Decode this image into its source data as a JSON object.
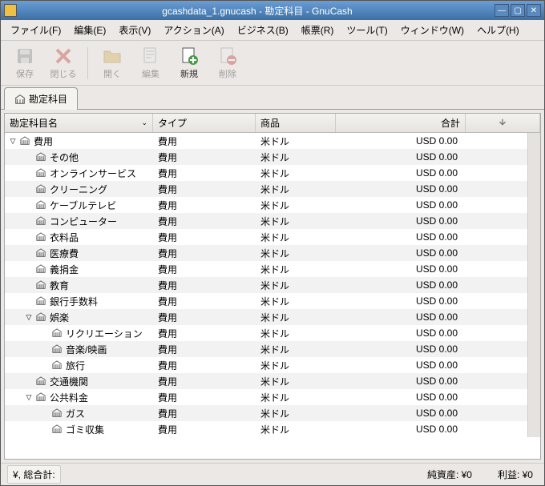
{
  "title": "gcashdata_1.gnucash - 勘定科目 - GnuCash",
  "menu": {
    "file": "ファイル(F)",
    "edit": "編集(E)",
    "view": "表示(V)",
    "actions": "アクション(A)",
    "business": "ビジネス(B)",
    "reports": "帳票(R)",
    "tools": "ツール(T)",
    "windows": "ウィンドウ(W)",
    "help": "ヘルプ(H)"
  },
  "toolbar": {
    "save": "保存",
    "close": "閉じる",
    "open": "開く",
    "edit": "編集",
    "new": "新規",
    "delete": "削除"
  },
  "tab": {
    "label": "勘定科目"
  },
  "headers": {
    "name": "勘定科目名",
    "type": "タイプ",
    "commodity": "商品",
    "total": "合計"
  },
  "rows": [
    {
      "indent": 0,
      "expander": "▽",
      "name": "費用",
      "type": "費用",
      "commodity": "米ドル",
      "total": "USD 0.00"
    },
    {
      "indent": 1,
      "expander": "",
      "name": "その他",
      "type": "費用",
      "commodity": "米ドル",
      "total": "USD 0.00"
    },
    {
      "indent": 1,
      "expander": "",
      "name": "オンラインサービス",
      "type": "費用",
      "commodity": "米ドル",
      "total": "USD 0.00"
    },
    {
      "indent": 1,
      "expander": "",
      "name": "クリーニング",
      "type": "費用",
      "commodity": "米ドル",
      "total": "USD 0.00"
    },
    {
      "indent": 1,
      "expander": "",
      "name": "ケーブルテレビ",
      "type": "費用",
      "commodity": "米ドル",
      "total": "USD 0.00"
    },
    {
      "indent": 1,
      "expander": "",
      "name": "コンピューター",
      "type": "費用",
      "commodity": "米ドル",
      "total": "USD 0.00"
    },
    {
      "indent": 1,
      "expander": "",
      "name": "衣料品",
      "type": "費用",
      "commodity": "米ドル",
      "total": "USD 0.00"
    },
    {
      "indent": 1,
      "expander": "",
      "name": "医療費",
      "type": "費用",
      "commodity": "米ドル",
      "total": "USD 0.00"
    },
    {
      "indent": 1,
      "expander": "",
      "name": "義捐金",
      "type": "費用",
      "commodity": "米ドル",
      "total": "USD 0.00"
    },
    {
      "indent": 1,
      "expander": "",
      "name": "教育",
      "type": "費用",
      "commodity": "米ドル",
      "total": "USD 0.00"
    },
    {
      "indent": 1,
      "expander": "",
      "name": "銀行手数料",
      "type": "費用",
      "commodity": "米ドル",
      "total": "USD 0.00"
    },
    {
      "indent": 1,
      "expander": "▽",
      "name": "娯楽",
      "type": "費用",
      "commodity": "米ドル",
      "total": "USD 0.00"
    },
    {
      "indent": 2,
      "expander": "",
      "name": "リクリエーション",
      "type": "費用",
      "commodity": "米ドル",
      "total": "USD 0.00"
    },
    {
      "indent": 2,
      "expander": "",
      "name": "音楽/映画",
      "type": "費用",
      "commodity": "米ドル",
      "total": "USD 0.00"
    },
    {
      "indent": 2,
      "expander": "",
      "name": "旅行",
      "type": "費用",
      "commodity": "米ドル",
      "total": "USD 0.00"
    },
    {
      "indent": 1,
      "expander": "",
      "name": "交通機関",
      "type": "費用",
      "commodity": "米ドル",
      "total": "USD 0.00"
    },
    {
      "indent": 1,
      "expander": "▽",
      "name": "公共料金",
      "type": "費用",
      "commodity": "米ドル",
      "total": "USD 0.00"
    },
    {
      "indent": 2,
      "expander": "",
      "name": "ガス",
      "type": "費用",
      "commodity": "米ドル",
      "total": "USD 0.00"
    },
    {
      "indent": 2,
      "expander": "",
      "name": "ゴミ収集",
      "type": "費用",
      "commodity": "米ドル",
      "total": "USD 0.00"
    }
  ],
  "status": {
    "grand_total_label": "¥, 総合計:",
    "net_assets": "純資産: ¥0",
    "profit": "利益: ¥0"
  }
}
